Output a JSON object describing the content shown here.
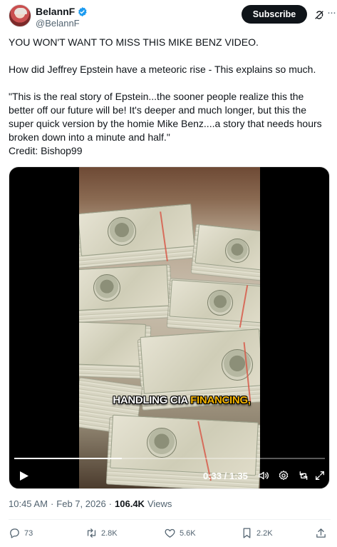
{
  "author": {
    "display_name": "BelannF",
    "handle": "@BelannF",
    "verified": true,
    "avatar_icon": "avatar-portrait"
  },
  "header": {
    "subscribe_label": "Subscribe",
    "grok_icon": "grok-icon",
    "more_icon": "more-icon"
  },
  "tweet": {
    "line1": "YOU WON'T WANT TO MISS THIS MIKE BENZ VIDEO.",
    "line2": "How did Jeffrey Epstein have a meteoric rise - This explains so much.",
    "line3": "\"This is the real story of Epstein...the sooner people realize this the better off our future will be! It's deeper and much longer, but this the super quick version by the homie Mike Benz....a story that needs hours broken down into a minute and half.\"",
    "credit": "Credit:  Bishop99"
  },
  "video": {
    "caption_white": "HANDLING CIA ",
    "caption_yellow": "FINANCING,",
    "current_time": "0:33",
    "duration": "1:35",
    "time_display": "0:33 / 1:35",
    "progress": 0.347,
    "icons": [
      "play-icon",
      "volume-icon",
      "settings-icon",
      "rotate-icon",
      "fullscreen-icon"
    ]
  },
  "meta": {
    "time": "10:45 AM",
    "dot1": "·",
    "date": "Feb 7, 2026",
    "dot2": "·",
    "views_count": "106.4K",
    "views_label": "Views"
  },
  "actions": {
    "replies": "73",
    "reposts": "2.8K",
    "likes": "5.6K",
    "bookmarks": "2.2K"
  },
  "colors": {
    "text": "#0f1419",
    "muted": "#536471",
    "verified_blue": "#1d9bf0",
    "caption_yellow": "#f5b400"
  }
}
